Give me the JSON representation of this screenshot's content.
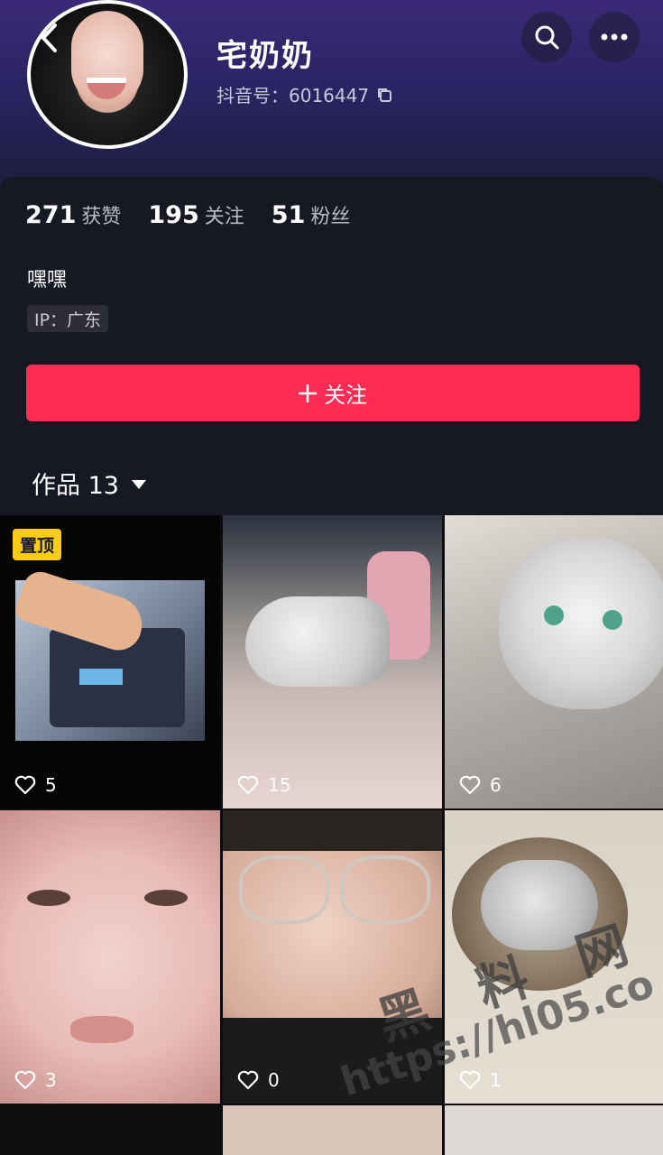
{
  "profile": {
    "name": "宅奶奶",
    "douyin_id": "抖音号：6016447"
  },
  "header": {
    "back_icon": "chevron-left-icon",
    "search_icon": "search-icon",
    "more_icon": "more-dots-icon"
  },
  "stats": [
    {
      "value": "271",
      "label": "获赞"
    },
    {
      "value": "195",
      "label": "关注"
    },
    {
      "value": "51",
      "label": "粉丝"
    }
  ],
  "bio": "嘿嘿",
  "ip": "IP：广东",
  "follow_button": "关注",
  "works": {
    "label": "作品 13"
  },
  "videos": [
    {
      "likes": "5",
      "pinned_label": "置顶"
    },
    {
      "likes": "15"
    },
    {
      "likes": "6"
    },
    {
      "likes": "3"
    },
    {
      "likes": "0"
    },
    {
      "likes": "1"
    }
  ],
  "watermark": {
    "title": "黑 料 网",
    "url": "https://hl05.co"
  },
  "colors": {
    "accent": "#fe2c55",
    "background": "#161823",
    "pin": "#facc15"
  }
}
